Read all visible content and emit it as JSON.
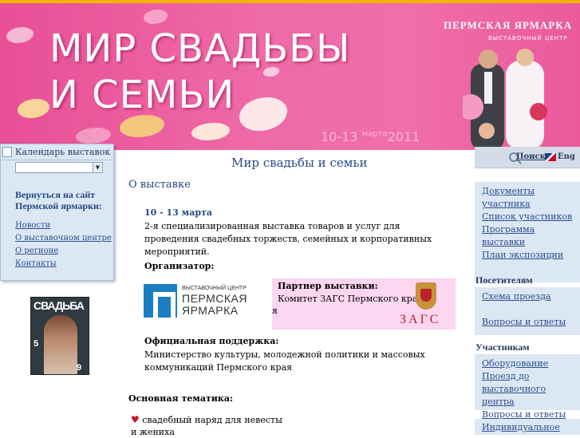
{
  "banner": {
    "title_line1": "МИР СВАДЬБЫ",
    "title_line2": "И СЕМЬИ",
    "dates": "10-13",
    "dates_month": "марта",
    "dates_year": "2011",
    "fair_logo": "ПЕРМСКАЯ ЯРМАРКА",
    "fair_logo_sub": "ВЫСТАВОЧНЫЙ ЦЕНТР"
  },
  "left_panel": {
    "calendar_label": "Календарь выставок",
    "calendar_value": "",
    "back_link": "Вернуться на сайт Пермской ярмарки:",
    "links": [
      "Новости",
      "О выставочном центре",
      "О регионе",
      "Контакты"
    ]
  },
  "magazine": {
    "title": "СВАДЬБА",
    "number_left": "5",
    "number_right": "9"
  },
  "main": {
    "title": "Мир свадьбы и семьи",
    "section": "О выставке",
    "dates": "10 - 13 марта",
    "description": "2-я специализированная выставка товаров и услуг для проведения свадебных торжеств, семейных и корпоративных мероприятий.",
    "organizer_label": "Организатор:",
    "organizer_logo_sub": "ВЫСТАВОЧНЫЙ ЦЕНТР",
    "organizer_logo_name": "ПЕРМСКАЯ ЯРМАРКА",
    "partner_label": "Партнер выставки:",
    "partner_name": "Комитет ЗАГС Пермского кра",
    "partner_overflow": "я",
    "partner_logo_text": "ЗАГС",
    "support_label": "Официальная поддержка:",
    "support_text": "Министерство культуры, молодежной политики и массовых коммуникаций Пермского края",
    "theme_label": "Основная тематика:",
    "theme_item": "свадебный наряд для невесты и жениха"
  },
  "right": {
    "search_label": "Поиск",
    "eng_label": "Eng",
    "section1_links": [
      "Документы участника",
      "Список участников",
      "Программа выставки",
      "План экспозиции"
    ],
    "visitors_head": "Посетителям",
    "visitors_links": [
      "Схема проезда",
      "Вопросы и ответы"
    ],
    "participants_head": "Участникам",
    "participants_links": [
      "Оборудование",
      "Проезд до выставочного центра",
      "Вопросы и ответы"
    ],
    "more_link": "Индивидуальное"
  },
  "colors": {
    "banner_pink": "#ef6aa8",
    "accent_blue": "#234a86",
    "panel_bg": "#dbe7f3",
    "partner_bg": "#fdd6f1"
  }
}
